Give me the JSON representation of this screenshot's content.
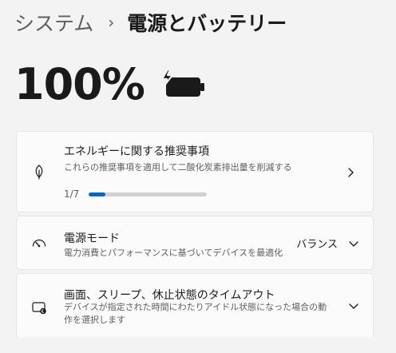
{
  "breadcrumb": {
    "parent": "システム",
    "separator": "›",
    "current": "電源とバッテリー"
  },
  "battery": {
    "percent_text": "100%",
    "icon": "battery-charging-icon"
  },
  "recommendations": {
    "icon": "leaf-icon",
    "title": "エネルギーに関する推奨事項",
    "subtitle": "これらの推奨事項を適用して二酸化炭素排出量を削減する",
    "progress_text": "1/7",
    "progress_fraction": 0.14285714285714285,
    "chevron_icon": "chevron-right-icon"
  },
  "power_mode": {
    "icon": "speedometer-icon",
    "title": "電源モード",
    "subtitle": "電力消費とパフォーマンスに基づいてデバイスを最適化",
    "selected_value": "バランス",
    "chevron_icon": "chevron-down-icon"
  },
  "timeout": {
    "icon": "screen-sleep-icon",
    "title": "画面、スリープ、休止状態のタイムアウト",
    "subtitle": "デバイスが指定された時間にわたりアイドル状態になった場合の動作を選択します",
    "chevron_icon": "chevron-down-icon"
  },
  "colors": {
    "accent": "#0067c0",
    "background": "#f3f3f3",
    "card": "#fbfbfb"
  }
}
